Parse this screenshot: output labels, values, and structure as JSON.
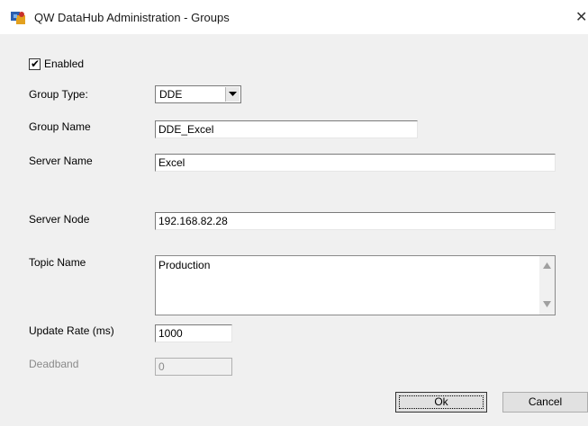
{
  "window": {
    "title": "QW DataHub Administration - Groups",
    "close_glyph": "✕",
    "icon": "app-icon"
  },
  "form": {
    "enabled": {
      "label": "Enabled",
      "checked": true
    },
    "group_type": {
      "label": "Group Type:",
      "value": "DDE"
    },
    "group_name": {
      "label": "Group Name",
      "value": "DDE_Excel"
    },
    "server_name": {
      "label": "Server Name",
      "value": "Excel"
    },
    "server_node": {
      "label": "Server Node",
      "value": "192.168.82.28"
    },
    "topic_name": {
      "label": "Topic Name",
      "value": "Production"
    },
    "update_rate": {
      "label": "Update Rate (ms)",
      "value": "1000"
    },
    "deadband": {
      "label": "Deadband",
      "value": "0",
      "disabled": true
    }
  },
  "buttons": {
    "ok": "Ok",
    "cancel": "Cancel"
  }
}
